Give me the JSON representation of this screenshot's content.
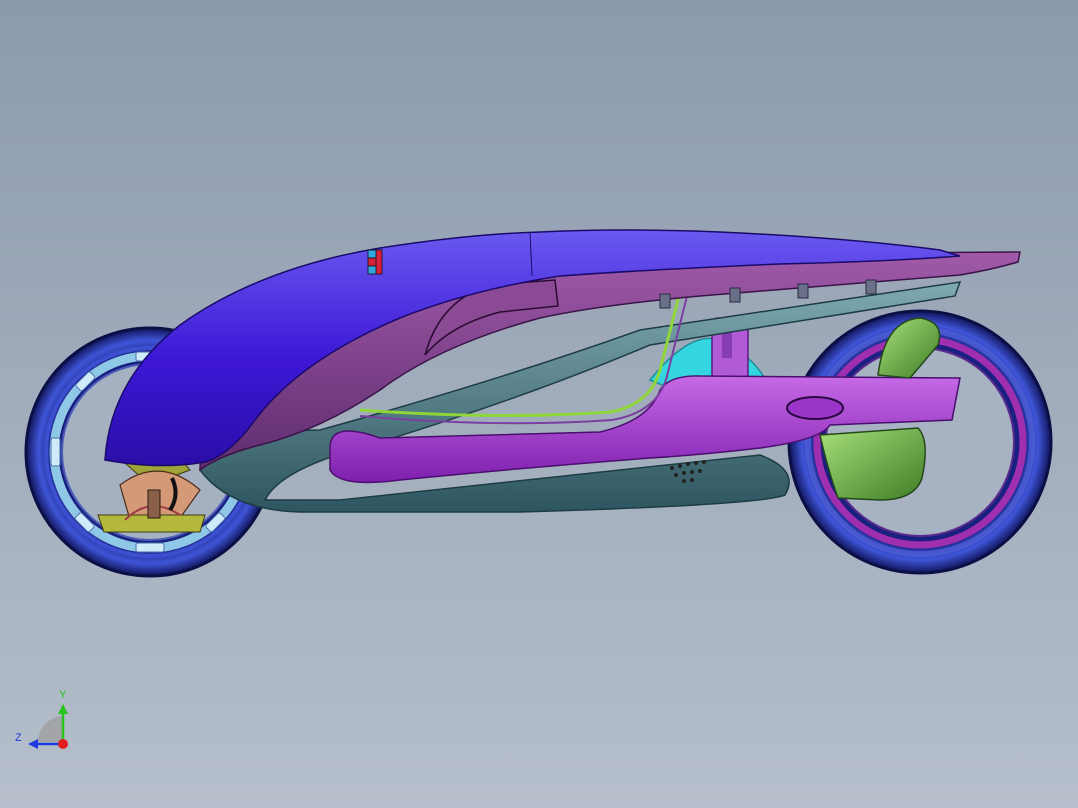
{
  "viewport": {
    "background_top": "#8c9aad",
    "background_bottom": "#b6bfcb"
  },
  "model": {
    "colors": {
      "canopy": "#3d17d6",
      "body_panel": "#7a3f86",
      "frame": "#3f6f78",
      "swingarm": "#9b34c9",
      "tire": "#2a3aa8",
      "rim_ring": "#8fc7e6",
      "suspension": "#36d6e0",
      "seat_green": "#6fb545",
      "mechanism_tan": "#d49a78",
      "mechanism_olive": "#9ea33a",
      "decal_red": "#d81f3c",
      "decal_blue": "#2fa6e0",
      "rear_hub": "#a02fb0"
    }
  },
  "triad": {
    "y_label": "Y",
    "z_label": "Z",
    "y_color": "#27c41e",
    "z_color": "#1e3ae0",
    "x_color": "#e01e1e",
    "sphere_color": "#9e9e9e"
  }
}
